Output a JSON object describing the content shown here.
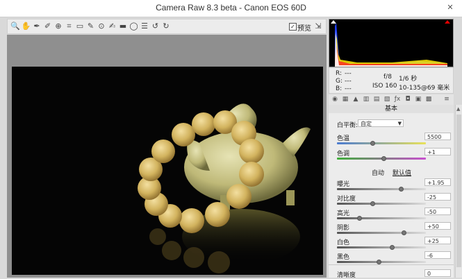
{
  "window": {
    "title": "Camera Raw 8.3 beta -  Canon EOS 60D"
  },
  "toolbar": {
    "tools": [
      {
        "name": "zoom-tool-icon",
        "glyph": "🔍"
      },
      {
        "name": "hand-tool-icon",
        "glyph": "✋"
      },
      {
        "name": "white-balance-tool-icon",
        "glyph": "✒"
      },
      {
        "name": "color-sampler-tool-icon",
        "glyph": "✐"
      },
      {
        "name": "targeted-adjustment-tool-icon",
        "glyph": "⊕"
      },
      {
        "name": "crop-tool-icon",
        "glyph": "⌗"
      },
      {
        "name": "straighten-tool-icon",
        "glyph": "▭"
      },
      {
        "name": "spot-removal-tool-icon",
        "glyph": "✎"
      },
      {
        "name": "red-eye-tool-icon",
        "glyph": "⊙"
      },
      {
        "name": "adjustment-brush-icon",
        "glyph": "✍"
      },
      {
        "name": "graduated-filter-icon",
        "glyph": "▬"
      },
      {
        "name": "radial-filter-icon",
        "glyph": "◯"
      },
      {
        "name": "preferences-icon",
        "glyph": "☰"
      },
      {
        "name": "rotate-left-icon",
        "glyph": "↺"
      },
      {
        "name": "rotate-right-icon",
        "glyph": "↻"
      }
    ],
    "preview_label": "预览"
  },
  "info": {
    "r_label": "R:",
    "g_label": "G:",
    "b_label": "B:",
    "r_value": "---",
    "g_value": "---",
    "b_value": "---",
    "aperture": "f/8",
    "shutter": "1/6 秒",
    "iso": "ISO 160",
    "lens": "10-135@69 毫米"
  },
  "panel": {
    "title": "基本",
    "white_balance_label": "白平衡:",
    "white_balance_value": "自定",
    "auto_link": "自动",
    "default_link": "默认值",
    "sliders": [
      {
        "id": "temperature",
        "label": "色温",
        "value": "5500",
        "pos": 0.4,
        "kind": "temp"
      },
      {
        "id": "tint",
        "label": "色调",
        "value": "+1",
        "pos": 0.52,
        "kind": "tint"
      },
      {
        "id": "exposure",
        "label": "曝光",
        "value": "+1.95",
        "pos": 0.72,
        "kind": "gray"
      },
      {
        "id": "contrast",
        "label": "对比度",
        "value": "-25",
        "pos": 0.4,
        "kind": "gray"
      },
      {
        "id": "highlights",
        "label": "高光",
        "value": "-50",
        "pos": 0.25,
        "kind": "gray"
      },
      {
        "id": "shadows",
        "label": "阴影",
        "value": "+50",
        "pos": 0.75,
        "kind": "gray"
      },
      {
        "id": "whites",
        "label": "白色",
        "value": "+25",
        "pos": 0.62,
        "kind": "gray"
      },
      {
        "id": "blacks",
        "label": "黑色",
        "value": "-6",
        "pos": 0.47,
        "kind": "gray"
      }
    ],
    "clarity_label": "清晰度",
    "clarity_value": "0"
  },
  "colors": {
    "accent": "#2e6fd6",
    "photo_bg": "#050505",
    "jade": "#c9c489"
  }
}
